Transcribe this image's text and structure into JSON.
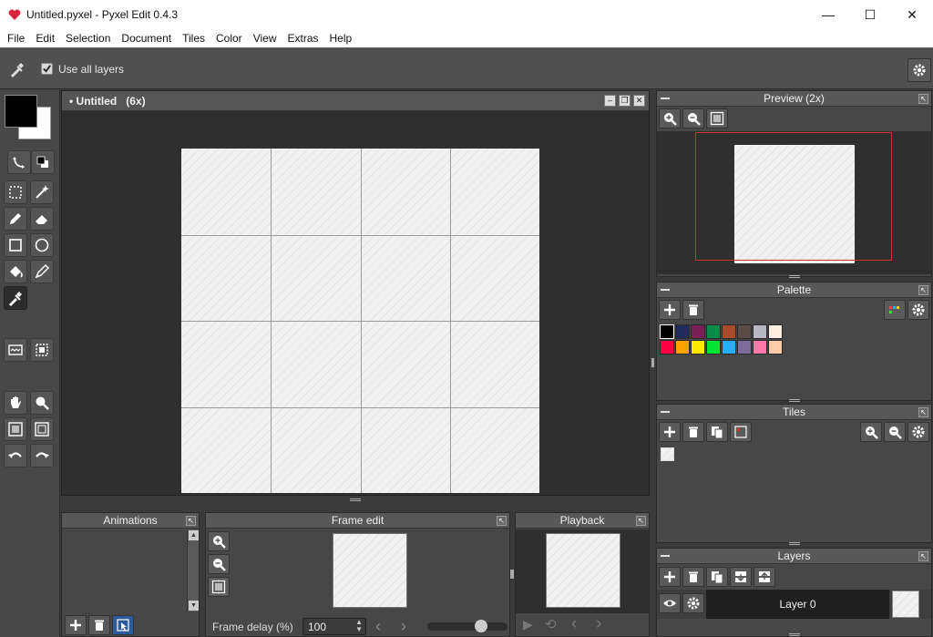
{
  "window": {
    "title": "Untitled.pyxel - Pyxel Edit 0.4.3",
    "minimize_glyph": "—",
    "maximize_glyph": "☐",
    "close_glyph": "✕"
  },
  "menu": [
    "File",
    "Edit",
    "Selection",
    "Document",
    "Tiles",
    "Color",
    "View",
    "Extras",
    "Help"
  ],
  "options_bar": {
    "use_all_layers_label": "Use all layers",
    "use_all_layers_checked": true
  },
  "colors": {
    "primary": "#000000",
    "secondary": "#ffffff",
    "accent_red": "#d03030"
  },
  "document": {
    "title": "• Untitled",
    "zoom": "(6x)",
    "grid_cols": 4,
    "grid_rows": 4
  },
  "panels": {
    "preview": {
      "title": "Preview (2x)"
    },
    "palette": {
      "title": "Palette",
      "swatches": [
        "#000000",
        "#222a5c",
        "#7a1f55",
        "#0c8a4a",
        "#a84c2c",
        "#5a4c47",
        "#b8b8c4",
        "#fff0e6",
        "#ff0046",
        "#ffa300",
        "#ffe900",
        "#00e436",
        "#29adff",
        "#7e6d9a",
        "#ff77a8",
        "#ffccaa"
      ]
    },
    "tiles": {
      "title": "Tiles"
    },
    "layers": {
      "title": "Layers",
      "items": [
        {
          "name": "Layer 0"
        }
      ]
    },
    "animations": {
      "title": "Animations"
    },
    "frame_edit": {
      "title": "Frame edit",
      "frame_delay_label": "Frame delay (%)",
      "frame_delay_value": "100",
      "slider_level": 0.7
    },
    "playback": {
      "title": "Playback"
    }
  }
}
